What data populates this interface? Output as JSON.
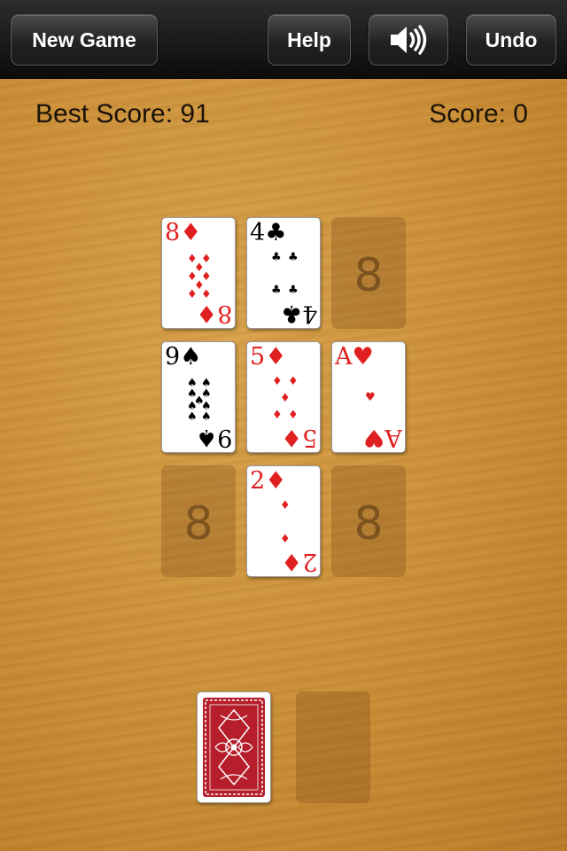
{
  "toolbar": {
    "new_game": "New Game",
    "help": "Help",
    "sound_icon": "speaker-icon",
    "undo": "Undo"
  },
  "scores": {
    "best": "Best Score: 91",
    "current": "Score: 0"
  },
  "slot_label": "8",
  "cards": [
    {
      "rank": "8",
      "suit": "♦",
      "color": "red"
    },
    {
      "rank": "4",
      "suit": "♣",
      "color": "black"
    },
    {
      "rank": "9",
      "suit": "♠",
      "color": "black"
    },
    {
      "rank": "5",
      "suit": "♦",
      "color": "red"
    },
    {
      "rank": "A",
      "suit": "♥",
      "color": "red"
    },
    {
      "rank": "2",
      "suit": "♦",
      "color": "red"
    }
  ],
  "colors": {
    "red_suit": "#e02020",
    "card_back": "#b51e2a"
  }
}
